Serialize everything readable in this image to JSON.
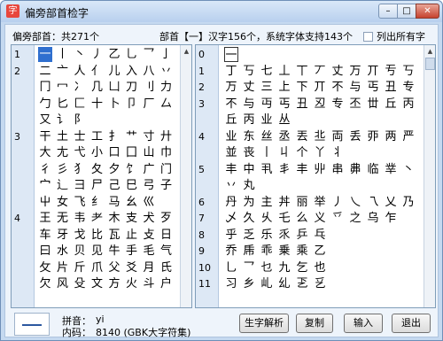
{
  "window": {
    "title": "偏旁部首检字",
    "app_icon": "字",
    "accent": "#2f6fcf",
    "close_color": "#c6422e"
  },
  "titlebar": {
    "min_glyph": "–",
    "max_glyph": "□",
    "close_glyph": "✕"
  },
  "header": {
    "radical_count": "偏旁部首：共271个",
    "status": "部首【一】汉字156个，系统字体支持143个",
    "show_all_label": "列出所有字",
    "show_all_checked": false
  },
  "left_panel": {
    "groups": [
      {
        "num": "1",
        "rows": [
          [
            "一",
            "丨",
            "丶",
            "丿",
            "乙",
            "乚",
            "乛",
            "亅"
          ]
        ]
      },
      {
        "num": "2",
        "rows": [
          [
            "二",
            "亠",
            "人",
            "亻",
            "儿",
            "入",
            "八",
            "丷"
          ],
          [
            "冂",
            "冖",
            "冫",
            "几",
            "凵",
            "刀",
            "刂",
            "力"
          ],
          [
            "勹",
            "匕",
            "匚",
            "十",
            "卜",
            "卩",
            "厂",
            "厶"
          ],
          [
            "又",
            "讠",
            "阝"
          ]
        ]
      },
      {
        "num": "3",
        "rows": [
          [
            "干",
            "土",
            "士",
            "工",
            "扌",
            "艹",
            "寸",
            "廾"
          ],
          [
            "大",
            "尢",
            "弋",
            "小",
            "口",
            "囗",
            "山",
            "巾"
          ],
          [
            "彳",
            "彡",
            "犭",
            "夂",
            "夕",
            "饣",
            "广",
            "门"
          ],
          [
            "宀",
            "辶",
            "彐",
            "尸",
            "己",
            "巳",
            "弓",
            "子"
          ],
          [
            "屮",
            "女",
            "飞",
            "纟",
            "马",
            "幺",
            "巛",
            ""
          ]
        ]
      },
      {
        "num": "4",
        "rows": [
          [
            "王",
            "无",
            "韦",
            "耂",
            "木",
            "支",
            "犬",
            "歹"
          ],
          [
            "车",
            "牙",
            "戈",
            "比",
            "瓦",
            "止",
            "攴",
            "日"
          ],
          [
            "曰",
            "水",
            "贝",
            "见",
            "牛",
            "手",
            "毛",
            "气"
          ],
          [
            "攵",
            "片",
            "斤",
            "爪",
            "父",
            "爻",
            "月",
            "氏"
          ],
          [
            "欠",
            "风",
            "殳",
            "文",
            "方",
            "火",
            "斗",
            "户"
          ]
        ]
      }
    ]
  },
  "right_panel": {
    "rows": [
      {
        "num": "0",
        "chars": [
          "一"
        ]
      },
      {
        "num": "1",
        "chars": [
          "丁",
          "丂",
          "七",
          "丄",
          "丅",
          "丆",
          "丈",
          "万",
          "丌",
          "亐",
          "丂"
        ]
      },
      {
        "num": "2",
        "chars": [
          "万",
          "丈",
          "三",
          "上",
          "下",
          "丌",
          "不",
          "与",
          "丐",
          "丑",
          "专"
        ]
      },
      {
        "num": "3",
        "chars": [
          "不",
          "与",
          "丏",
          "丐",
          "丑",
          "丒",
          "专",
          "丕",
          "丗",
          "丘",
          "丙"
        ]
      },
      {
        "num": "",
        "chars": [
          "丘",
          "丙",
          "业",
          "丛"
        ]
      },
      {
        "num": "4",
        "chars": [
          "业",
          "东",
          "丝",
          "丞",
          "丟",
          "丠",
          "両",
          "丢",
          "丣",
          "两",
          "严"
        ]
      },
      {
        "num": "",
        "chars": [
          "並",
          "丧",
          "丨",
          "丩",
          "个",
          "丫",
          "丬"
        ]
      },
      {
        "num": "5",
        "chars": [
          "丰",
          "中",
          "丮",
          "丯",
          "丰",
          "丱",
          "串",
          "丳",
          "临",
          "丵",
          "丶"
        ]
      },
      {
        "num": "",
        "chars": [
          "丷",
          "丸"
        ]
      },
      {
        "num": "6",
        "chars": [
          "丹",
          "为",
          "主",
          "丼",
          "丽",
          "举",
          "丿",
          "乀",
          "乁",
          "乂",
          "乃"
        ]
      },
      {
        "num": "7",
        "chars": [
          "乄",
          "久",
          "乆",
          "乇",
          "么",
          "义",
          "乊",
          "之",
          "乌",
          "乍"
        ]
      },
      {
        "num": "8",
        "chars": [
          "乎",
          "乏",
          "乐",
          "乑",
          "乒",
          "乓"
        ]
      },
      {
        "num": "9",
        "chars": [
          "乔",
          "乕",
          "乖",
          "乗",
          "乘",
          "乙"
        ]
      },
      {
        "num": "10",
        "chars": [
          "乚",
          "乛",
          "乜",
          "九",
          "乞",
          "也"
        ]
      },
      {
        "num": "11",
        "chars": [
          "习",
          "乡",
          "乢",
          "乣",
          "乤",
          "乥"
        ]
      }
    ]
  },
  "footer": {
    "pinyin_label": "拼音：",
    "pinyin_value": "yi",
    "code_label": "内码：",
    "code_value": "8140 (GBK大字符集)",
    "buttons": {
      "analyze": "生字解析",
      "copy": "复制",
      "input": "输入",
      "exit": "退出"
    }
  }
}
